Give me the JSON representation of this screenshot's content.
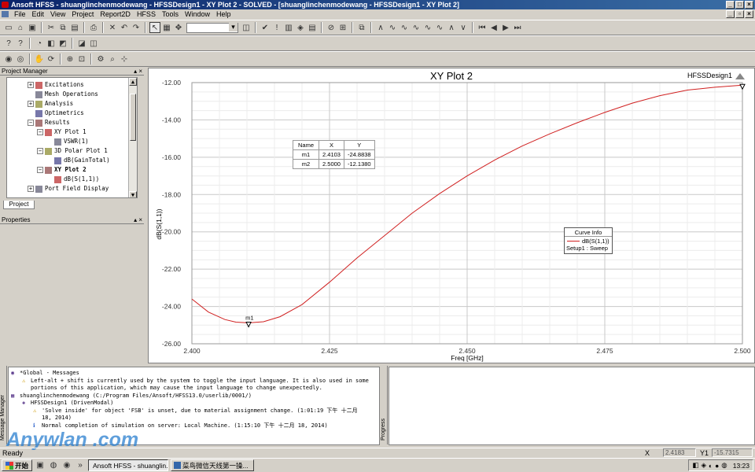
{
  "window": {
    "title": "Ansoft HFSS - shuanglinchenmodewang - HFSSDesign1 - XY Plot 2 - SOLVED - [shuanglinchenmodewang - HFSSDesign1 - XY Plot 2]"
  },
  "menu": [
    "File",
    "Edit",
    "View",
    "Project",
    "Report2D",
    "HFSS",
    "Tools",
    "Window",
    "Help"
  ],
  "project_manager": {
    "title": "Project Manager",
    "tab": "Project",
    "items": [
      {
        "label": "Excitations",
        "level": 0,
        "expander": "+"
      },
      {
        "label": "Mesh Operations",
        "level": 0,
        "expander": ""
      },
      {
        "label": "Analysis",
        "level": 0,
        "expander": "+"
      },
      {
        "label": "Optimetrics",
        "level": 0,
        "expander": ""
      },
      {
        "label": "Results",
        "level": 0,
        "expander": "−"
      },
      {
        "label": "XY Plot 1",
        "level": 1,
        "expander": "−"
      },
      {
        "label": "VSWR(1)",
        "level": 2,
        "expander": ""
      },
      {
        "label": "3D Polar Plot 1",
        "level": 1,
        "expander": "−"
      },
      {
        "label": "dB(GainTotal)",
        "level": 2,
        "expander": ""
      },
      {
        "label": "XY Plot 2",
        "level": 1,
        "expander": "−",
        "bold": true
      },
      {
        "label": "dB(S(1,1))",
        "level": 2,
        "expander": ""
      },
      {
        "label": "Port Field Display",
        "level": 0,
        "expander": "+"
      }
    ]
  },
  "properties": {
    "title": "Properties"
  },
  "plot": {
    "title": "XY Plot 2",
    "design": "HFSSDesign1",
    "marker_label": "m1",
    "marker_table": {
      "headers": [
        "Name",
        "X",
        "Y"
      ],
      "rows": [
        [
          "m1",
          "2.4103",
          "-24.8838"
        ],
        [
          "m2",
          "2.5000",
          "-12.1380"
        ]
      ]
    },
    "curve_info": {
      "title": "Curve Info",
      "curve": "dB(S(1,1))",
      "setup": "Setup1 : Sweep"
    },
    "curve_color": "#d02020"
  },
  "chart_data": {
    "type": "line",
    "title": "XY Plot 2",
    "xlabel": "Freq [GHz]",
    "ylabel": "dB(S(1,1))",
    "xlim": [
      2.4,
      2.5
    ],
    "ylim": [
      -26,
      -12
    ],
    "x_ticks": [
      "2.400",
      "2.425",
      "2.450",
      "2.475",
      "2.500"
    ],
    "y_ticks": [
      "-12.00",
      "-14.00",
      "-16.00",
      "-18.00",
      "-20.00",
      "-22.00",
      "-24.00",
      "-26.00"
    ],
    "grid": true,
    "series": [
      {
        "name": "dB(S(1,1))",
        "x": [
          2.4,
          2.403,
          2.406,
          2.408,
          2.4103,
          2.413,
          2.416,
          2.42,
          2.425,
          2.43,
          2.435,
          2.44,
          2.445,
          2.45,
          2.455,
          2.46,
          2.465,
          2.47,
          2.475,
          2.48,
          2.485,
          2.49,
          2.495,
          2.5
        ],
        "y": [
          -23.6,
          -24.3,
          -24.7,
          -24.84,
          -24.88,
          -24.82,
          -24.55,
          -23.9,
          -22.7,
          -21.4,
          -20.2,
          -19.0,
          -17.95,
          -17.0,
          -16.15,
          -15.4,
          -14.75,
          -14.15,
          -13.6,
          -13.1,
          -12.7,
          -12.4,
          -12.25,
          -12.14
        ]
      }
    ]
  },
  "messages": {
    "panel_title": "Message Manager",
    "items": [
      {
        "text": "*Global - Messages",
        "level": 0,
        "icon": "global"
      },
      {
        "text": "Left-alt + shift is currently used by the system to toggle the input language. It is also used in some",
        "level": 1,
        "icon": "warning"
      },
      {
        "text": "portions of this application, which may cause the input language to change unexpectedly.",
        "level": 1,
        "icon": ""
      },
      {
        "text": "shuanglinchenmodewang (C:/Program Files/Ansoft/HFSS13.0/userlib/0001/)",
        "level": 0,
        "icon": "project"
      },
      {
        "text": "HFSSDesign1 (DrivenModal)",
        "level": 1,
        "icon": "design"
      },
      {
        "text": "'Solve inside' for object 'FSB' is unset, due to material assignment change. (1:01:19 下午  十二月",
        "level": 2,
        "icon": "warning"
      },
      {
        "text": "18, 2014)",
        "level": 2,
        "icon": ""
      },
      {
        "text": "Normal completion of simulation on server: Local Machine. (1:15:10 下午  十二月 18, 2014)",
        "level": 2,
        "icon": "info"
      }
    ]
  },
  "progress": {
    "title": "Progress"
  },
  "watermark": "Anywlan .com",
  "statusbar": {
    "text": "Ready",
    "x_label": "X",
    "x_value": "2.4183",
    "y_label": "Y1",
    "y_value": "-15.7315"
  },
  "taskbar": {
    "start": "开始",
    "buttons": [
      "Ansoft HFSS - shuanglin...",
      "菜鸟微信天线第一操..."
    ],
    "clock": "13:23"
  }
}
